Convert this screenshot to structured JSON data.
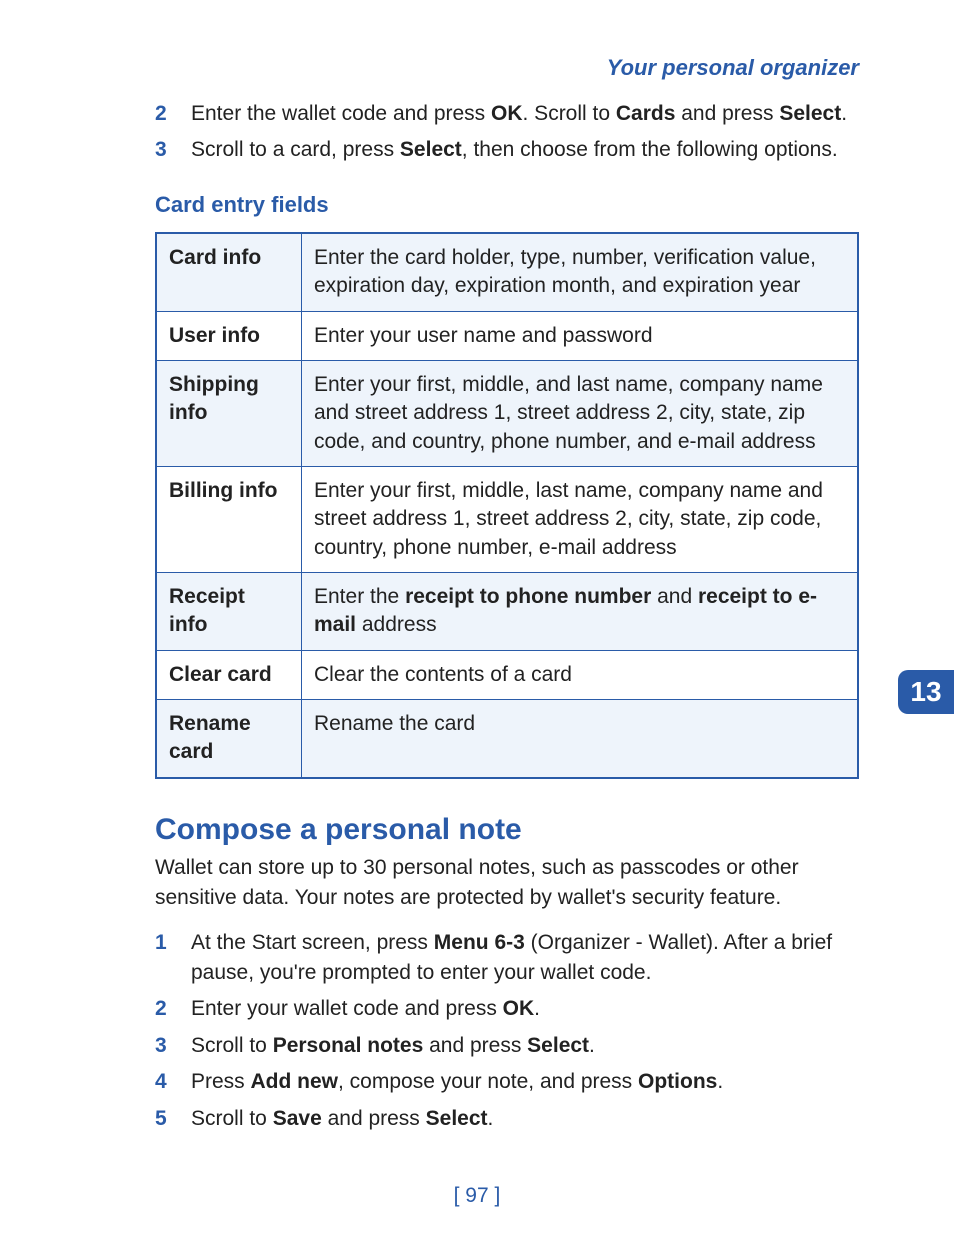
{
  "header": "Your personal organizer",
  "chapter_tab": "13",
  "page_number": "[ 97 ]",
  "intro_steps": [
    {
      "n": "2",
      "parts": [
        {
          "t": "Enter the wallet code and press ",
          "b": false
        },
        {
          "t": "OK",
          "b": true
        },
        {
          "t": ". Scroll to ",
          "b": false
        },
        {
          "t": "Cards",
          "b": true
        },
        {
          "t": " and press ",
          "b": false
        },
        {
          "t": "Select",
          "b": true
        },
        {
          "t": ".",
          "b": false
        }
      ]
    },
    {
      "n": "3",
      "parts": [
        {
          "t": "Scroll to a card, press ",
          "b": false
        },
        {
          "t": "Select",
          "b": true
        },
        {
          "t": ", then choose from the following options.",
          "b": false
        }
      ]
    }
  ],
  "table_heading": "Card entry fields",
  "table_rows": [
    {
      "label": "Card info",
      "parts": [
        {
          "t": "Enter the card holder, type, number, verification value, expiration day, expiration month, and expiration year",
          "b": false
        }
      ]
    },
    {
      "label": "User info",
      "parts": [
        {
          "t": "Enter your user name and password",
          "b": false
        }
      ]
    },
    {
      "label": "Shipping info",
      "parts": [
        {
          "t": "Enter your first, middle, and last name, company name and street address 1, street address 2, city, state, zip code, and country, phone number, and e-mail address",
          "b": false
        }
      ]
    },
    {
      "label": "Billing info",
      "parts": [
        {
          "t": "Enter your first, middle, last name, company name and street address 1, street address 2, city, state, zip code, country, phone number, e-mail address",
          "b": false
        }
      ]
    },
    {
      "label": "Receipt info",
      "parts": [
        {
          "t": "Enter the ",
          "b": false
        },
        {
          "t": "receipt to phone number",
          "b": true
        },
        {
          "t": " and ",
          "b": false
        },
        {
          "t": "receipt to e-mail",
          "b": true
        },
        {
          "t": " address",
          "b": false
        }
      ]
    },
    {
      "label": "Clear card",
      "parts": [
        {
          "t": "Clear the contents of a card",
          "b": false
        }
      ]
    },
    {
      "label": "Rename card",
      "parts": [
        {
          "t": "Rename the card",
          "b": false
        }
      ]
    }
  ],
  "section_heading": "Compose a personal note",
  "section_para": "Wallet can store up to 30 personal notes, such as passcodes or other sensitive data. Your notes are protected by wallet's security feature.",
  "section_steps": [
    {
      "n": "1",
      "parts": [
        {
          "t": "At the Start screen, press ",
          "b": false
        },
        {
          "t": "Menu 6-3",
          "b": true
        },
        {
          "t": " (Organizer - Wallet). After a brief pause, you're prompted to enter your wallet code.",
          "b": false
        }
      ]
    },
    {
      "n": "2",
      "parts": [
        {
          "t": "Enter your wallet code and press ",
          "b": false
        },
        {
          "t": "OK",
          "b": true
        },
        {
          "t": ".",
          "b": false
        }
      ]
    },
    {
      "n": "3",
      "parts": [
        {
          "t": "Scroll to ",
          "b": false
        },
        {
          "t": "Personal notes",
          "b": true
        },
        {
          "t": " and press ",
          "b": false
        },
        {
          "t": "Select",
          "b": true
        },
        {
          "t": ".",
          "b": false
        }
      ]
    },
    {
      "n": "4",
      "parts": [
        {
          "t": "Press ",
          "b": false
        },
        {
          "t": "Add new",
          "b": true
        },
        {
          "t": ", compose your note, and press ",
          "b": false
        },
        {
          "t": "Options",
          "b": true
        },
        {
          "t": ".",
          "b": false
        }
      ]
    },
    {
      "n": "5",
      "parts": [
        {
          "t": "Scroll to ",
          "b": false
        },
        {
          "t": "Save",
          "b": true
        },
        {
          "t": " and press ",
          "b": false
        },
        {
          "t": "Select",
          "b": true
        },
        {
          "t": ".",
          "b": false
        }
      ]
    }
  ]
}
